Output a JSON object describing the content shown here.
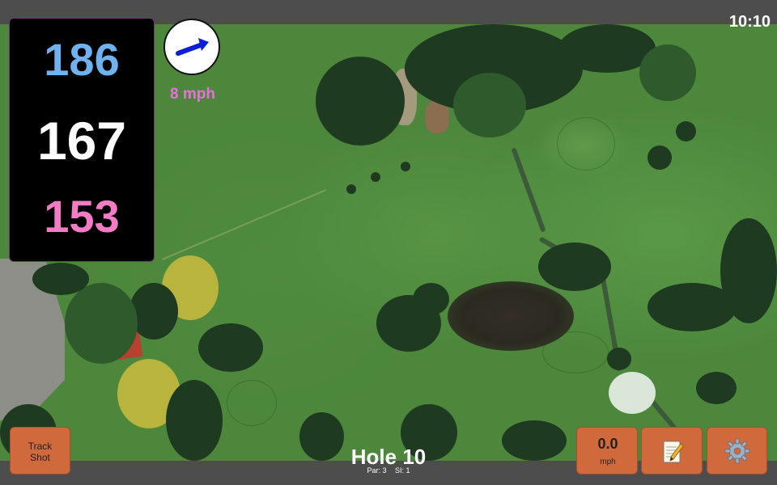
{
  "clock": {
    "time": "10:10"
  },
  "distances": {
    "back": "186",
    "middle": "167",
    "front": "153"
  },
  "wind": {
    "speed_label": "8 mph",
    "icon": "wind-arrow-icon"
  },
  "hole": {
    "title": "Hole 10",
    "par_label": "Par: 3",
    "si_label": "SI: 1"
  },
  "buttons": {
    "track_shot_line1": "Track",
    "track_shot_line2": "Shot",
    "speed_value": "0.0",
    "speed_unit": "mph",
    "notes_icon": "notepad-icon",
    "settings_icon": "gear-icon"
  },
  "colors": {
    "back_distance": "#6fb2f2",
    "middle_distance": "#ffffff",
    "front_distance": "#f37cc4",
    "wind_label": "#ef6ce0",
    "button": "#d06a3c"
  }
}
